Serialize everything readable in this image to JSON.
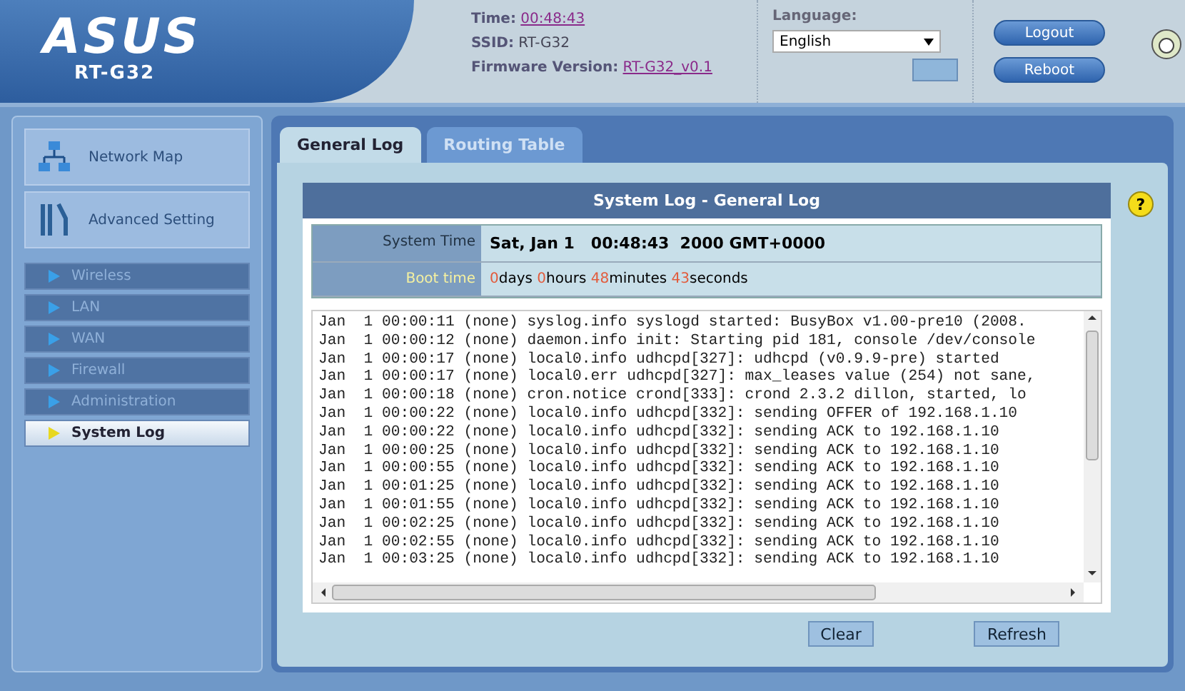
{
  "header": {
    "brand": "ASUS",
    "model": "RT-G32",
    "time_label": "Time:",
    "time": "00:48:43",
    "ssid_label": "SSID:",
    "ssid": "RT-G32",
    "firmware_label": "Firmware Version:",
    "firmware": "RT-G32_v0.1",
    "language_label": "Language:",
    "language": "English",
    "buttons": [
      "Logout",
      "Reboot"
    ]
  },
  "sidebar": {
    "items": [
      {
        "label": "Network Map",
        "kind": "network"
      },
      {
        "label": "Advanced Setting",
        "kind": "tools"
      }
    ],
    "submenu": [
      {
        "label": "Wireless",
        "selected": false
      },
      {
        "label": "LAN",
        "selected": false
      },
      {
        "label": "WAN",
        "selected": false
      },
      {
        "label": "Firewall",
        "selected": false
      },
      {
        "label": "Administration",
        "selected": false
      },
      {
        "label": "System Log",
        "selected": true
      }
    ]
  },
  "tabs": [
    {
      "label": "General Log",
      "selected": true
    },
    {
      "label": "Routing Table",
      "selected": false
    }
  ],
  "help": "?",
  "panel": {
    "title": "System Log - General Log",
    "system_time_label": "System Time",
    "system_time": "Sat, Jan 1   00:48:43  2000 GMT+0000",
    "boot_time_label": "Boot time",
    "uptime": [
      {
        "value": "0",
        "unit": "days"
      },
      {
        "value": "0",
        "unit": "hours"
      },
      {
        "value": "48",
        "unit": "minutes"
      },
      {
        "value": "43",
        "unit": "seconds"
      }
    ],
    "log": [
      "Jan  1 00:00:11 (none) syslog.info syslogd started: BusyBox v1.00-pre10 (2008.",
      "Jan  1 00:00:12 (none) daemon.info init: Starting pid 181, console /dev/console",
      "Jan  1 00:00:17 (none) local0.info udhcpd[327]: udhcpd (v0.9.9-pre) started",
      "Jan  1 00:00:17 (none) local0.err udhcpd[327]: max_leases value (254) not sane,",
      "Jan  1 00:00:18 (none) cron.notice crond[333]: crond 2.3.2 dillon, started, lo",
      "Jan  1 00:00:22 (none) local0.info udhcpd[332]: sending OFFER of 192.168.1.10",
      "Jan  1 00:00:22 (none) local0.info udhcpd[332]: sending ACK to 192.168.1.10",
      "Jan  1 00:00:25 (none) local0.info udhcpd[332]: sending ACK to 192.168.1.10",
      "Jan  1 00:00:55 (none) local0.info udhcpd[332]: sending ACK to 192.168.1.10",
      "Jan  1 00:01:25 (none) local0.info udhcpd[332]: sending ACK to 192.168.1.10",
      "Jan  1 00:01:55 (none) local0.info udhcpd[332]: sending ACK to 192.168.1.10",
      "Jan  1 00:02:25 (none) local0.info udhcpd[332]: sending ACK to 192.168.1.10",
      "Jan  1 00:02:55 (none) local0.info udhcpd[332]: sending ACK to 192.168.1.10",
      "Jan  1 00:03:25 (none) local0.info udhcpd[332]: sending ACK to 192.168.1.10"
    ],
    "buttons": [
      "Clear",
      "Refresh"
    ]
  }
}
